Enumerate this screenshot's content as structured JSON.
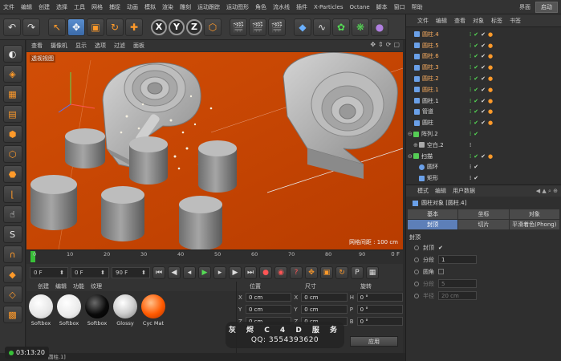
{
  "menubar": {
    "items": [
      "文件",
      "编辑",
      "创建",
      "选择",
      "工具",
      "网格",
      "捕捉",
      "动画",
      "模拟",
      "渲染",
      "雕刻",
      "运动跟踪",
      "运动图形",
      "角色",
      "流水线",
      "插件",
      "X-Particles",
      "Octane",
      "脚本",
      "窗口",
      "帮助"
    ],
    "layout_label": "界面",
    "layout_value": "启动"
  },
  "viewport": {
    "menu": [
      "查看",
      "摄像机",
      "显示",
      "选项",
      "过滤",
      "面板"
    ],
    "title": "透视视图",
    "grid_distance": "网格间距 : 100 cm",
    "background": "#c44400"
  },
  "timeline": {
    "ticks": [
      "0",
      "10",
      "20",
      "30",
      "40",
      "50",
      "60",
      "70",
      "80",
      "90"
    ],
    "end_frame": "0 F"
  },
  "transport": {
    "current_frame": "0 F",
    "start_frame": "0 F",
    "end_frame": "90 F"
  },
  "materials": {
    "menu": [
      "创建",
      "编辑",
      "功能",
      "纹理"
    ],
    "items": [
      {
        "name": "Softbox",
        "color": "#ffffff"
      },
      {
        "name": "Softbox",
        "color": "#f4f4f4"
      },
      {
        "name": "Softbox",
        "color": "#0a0a0a"
      },
      {
        "name": "Glossy",
        "color": "#d8d8d8"
      },
      {
        "name": "Cyc Mat",
        "color": "#ff5a00"
      }
    ]
  },
  "coords": {
    "headers": [
      "位置",
      "尺寸",
      "旋转"
    ],
    "rows": [
      {
        "pos_axis": "X",
        "pos": "0 cm",
        "size_axis": "X",
        "size": "0 cm",
        "rot_axis": "H",
        "rot": "0 °"
      },
      {
        "pos_axis": "Y",
        "pos": "0 cm",
        "size_axis": "Y",
        "size": "0 cm",
        "rot_axis": "P",
        "rot": "0 °"
      },
      {
        "pos_axis": "Z",
        "pos": "0 cm",
        "size_axis": "Z",
        "size": "0 cm",
        "rot_axis": "B",
        "rot": "0 °"
      }
    ],
    "mode": "对象 (相对)",
    "size_mode": "绝对尺寸",
    "apply": "应用"
  },
  "status": {
    "text": "圆柱.1]",
    "timer": "03:13:20"
  },
  "watermark": {
    "line1": "灰 烬 C 4 D 服 务",
    "line2": "QQ: 3554393620"
  },
  "object_manager": {
    "tabs": [
      "文件",
      "编辑",
      "查看",
      "对象",
      "标签",
      "书签"
    ],
    "objects": [
      {
        "name": "圆柱.4",
        "color": "#6aa0e8"
      },
      {
        "name": "圆柱.5",
        "color": "#6aa0e8"
      },
      {
        "name": "圆柱.6",
        "color": "#6aa0e8"
      },
      {
        "name": "圆柱.3",
        "color": "#6aa0e8"
      },
      {
        "name": "圆柱.2",
        "color": "#6aa0e8"
      },
      {
        "name": "圆柱.1",
        "color": "#6aa0e8"
      },
      {
        "name": "圆柱.1",
        "color": "#6aa0e8"
      },
      {
        "name": "管道",
        "color": "#6aa0e8"
      },
      {
        "name": "圆柱",
        "color": "#6aa0e8"
      },
      {
        "name": "阵列.2",
        "color": "#55cc55"
      },
      {
        "name": "空白.2",
        "color": "#aaaaaa"
      },
      {
        "name": "扫描",
        "color": "#55cc55"
      },
      {
        "name": "圆环",
        "color": "#6aa0e8"
      },
      {
        "name": "矩形",
        "color": "#6aa0e8"
      }
    ]
  },
  "attributes": {
    "menu": [
      "模式",
      "编辑",
      "用户数据"
    ],
    "object_title": "圆柱对象 [圆柱.4]",
    "tabs": [
      {
        "label": "基本",
        "active": false
      },
      {
        "label": "坐标",
        "active": false
      },
      {
        "label": "对象",
        "active": false
      },
      {
        "label": "封顶",
        "active": true
      },
      {
        "label": "切片",
        "active": false
      },
      {
        "label": "平滑着色(Phong)",
        "active": false
      }
    ],
    "section": "封顶",
    "caps_label": "封顶",
    "caps_check": "✔",
    "segments_label": "分段",
    "segments_value": "1",
    "fillet_label": "圆角",
    "fillet_segments_label": "分段",
    "fillet_segments_value": "5",
    "radius_label": "半径",
    "radius_value": "20 cm"
  }
}
